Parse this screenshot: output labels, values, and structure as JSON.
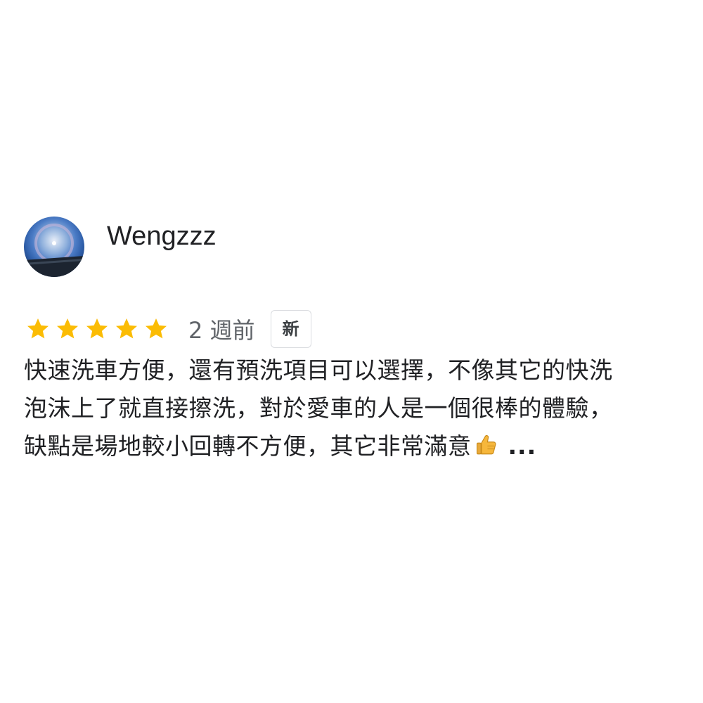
{
  "review": {
    "author": "Wengzzz",
    "rating": 5,
    "rating_max": 5,
    "time_ago": "2 週前",
    "badge": "新",
    "text_lines": [
      "快速洗車方便，還有預洗項目可以選擇，不像其它的快洗",
      "泡沫上了就直接擦洗，對於愛車的人是一個很棒的體驗，",
      "缺點是場地較小回轉不方便，其它非常滿意"
    ],
    "more_label": "...",
    "emoji": "thumbs-up-icon"
  },
  "colors": {
    "star": "#fbbc04",
    "text": "#202124",
    "secondary_text": "#5f6368",
    "badge_border": "#dadce0"
  }
}
